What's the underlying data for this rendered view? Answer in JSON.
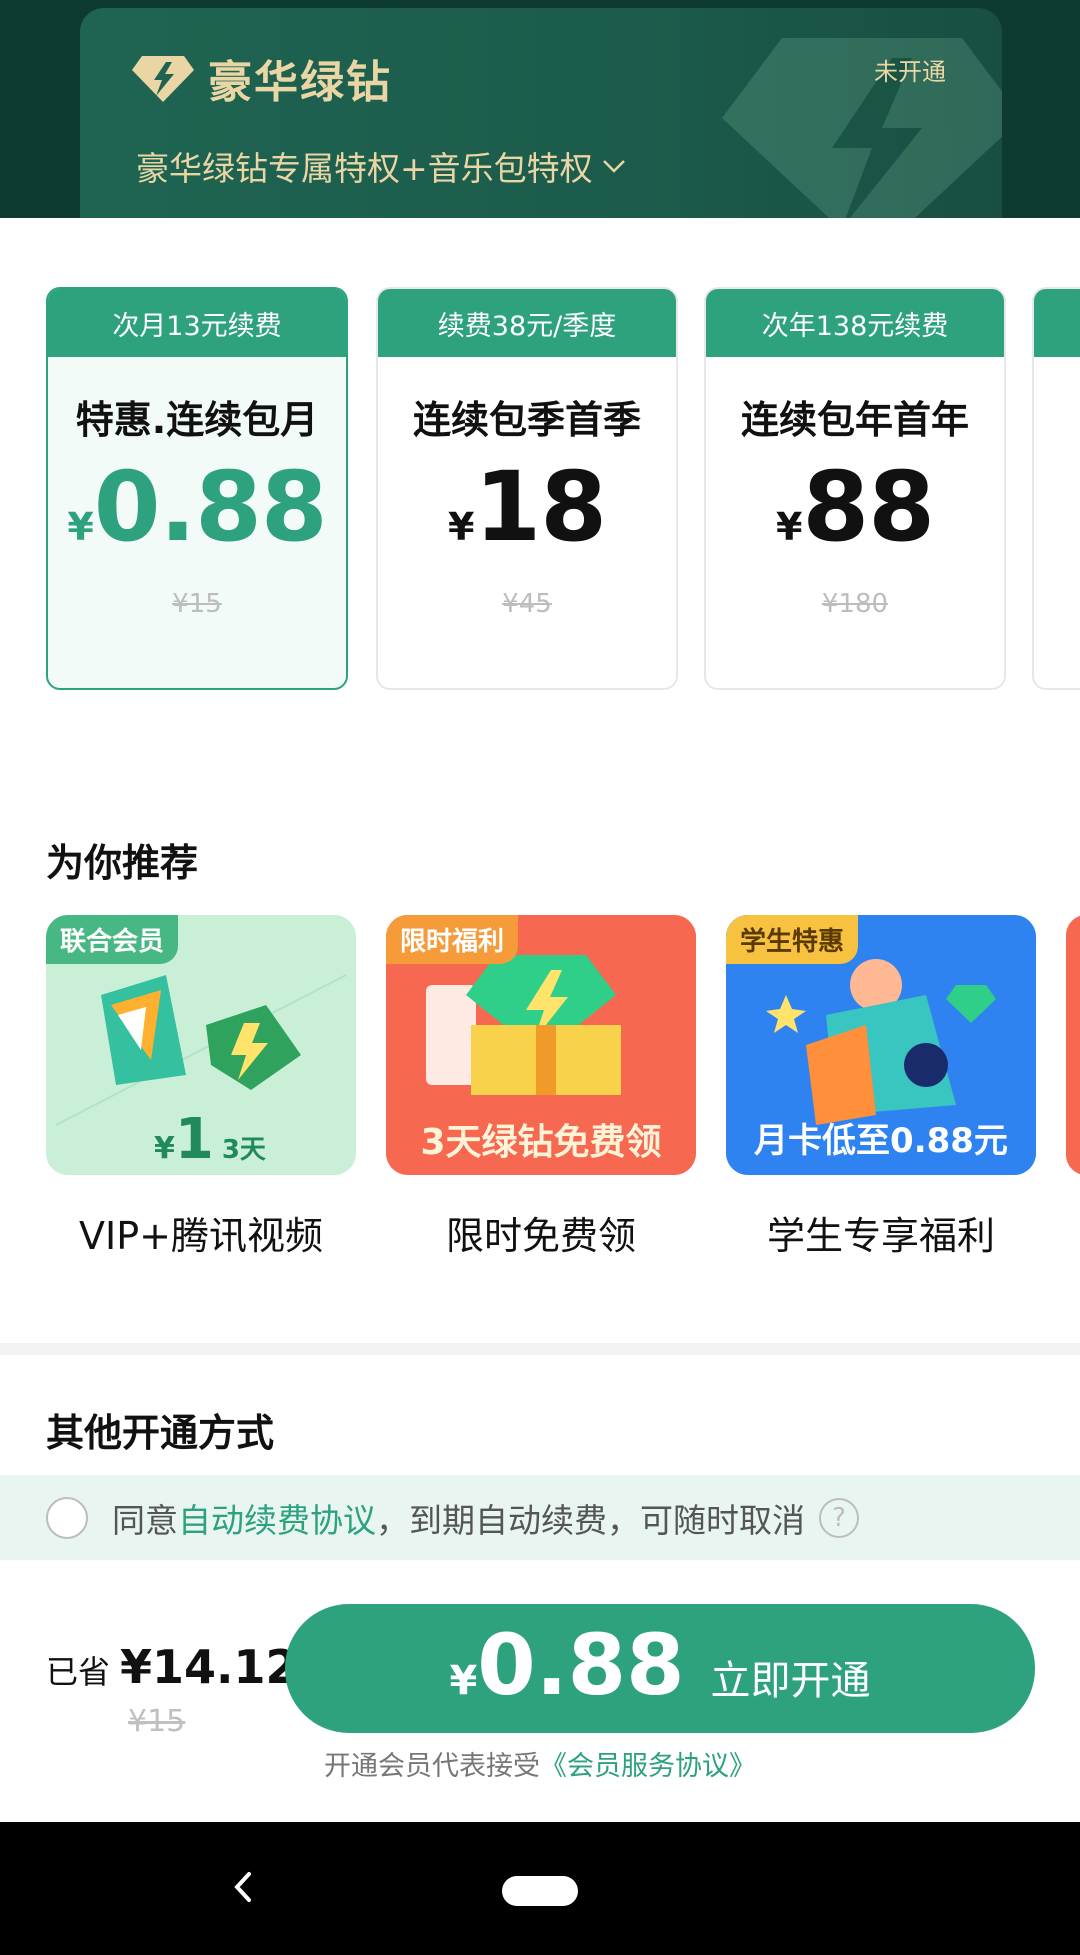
{
  "header": {
    "brand": "豪华绿钻",
    "status": "未开通",
    "privilege": "豪华绿钻专属特权+音乐包特权"
  },
  "plans": [
    {
      "tag": "次月13元续费",
      "name": "特惠.连续包月",
      "yen": "¥",
      "price": "0.88",
      "original": "¥15",
      "selected": true
    },
    {
      "tag": "续费38元/季度",
      "name": "连续包季首季",
      "yen": "¥",
      "price": "18",
      "original": "¥45",
      "selected": false
    },
    {
      "tag": "次年138元续费",
      "name": "连续包年首年",
      "yen": "¥",
      "price": "88",
      "original": "¥180",
      "selected": false
    }
  ],
  "recommend": {
    "title": "为你推荐",
    "items": [
      {
        "badge": "联合会员",
        "label": "VIP+腾讯视频",
        "art_price_yen": "¥",
        "art_price": "1",
        "art_unit": "3天"
      },
      {
        "badge": "限时福利",
        "label": "限时免费领",
        "art_text": "3天绿钻免费领"
      },
      {
        "badge": "学生特惠",
        "label": "学生专享福利",
        "art_text": "月卡低至0.88元"
      }
    ]
  },
  "other": {
    "title": "其他开通方式"
  },
  "agreement": {
    "prefix": "同意",
    "link": "自动续费协议",
    "suffix": "，到期自动续费，可随时取消",
    "help": "?"
  },
  "checkout": {
    "saved_label": "已省",
    "saved_amount": "¥14.12",
    "saved_original": "¥15",
    "pay_yen": "¥",
    "pay_price": "0.88",
    "pay_label": "立即开通",
    "terms_prefix": "开通会员代表接受",
    "terms_link": "《会员服务协议》"
  },
  "colors": {
    "accent": "#2ea17f",
    "header_bg": "#0e3b31",
    "gold": "#e9d6a4"
  }
}
